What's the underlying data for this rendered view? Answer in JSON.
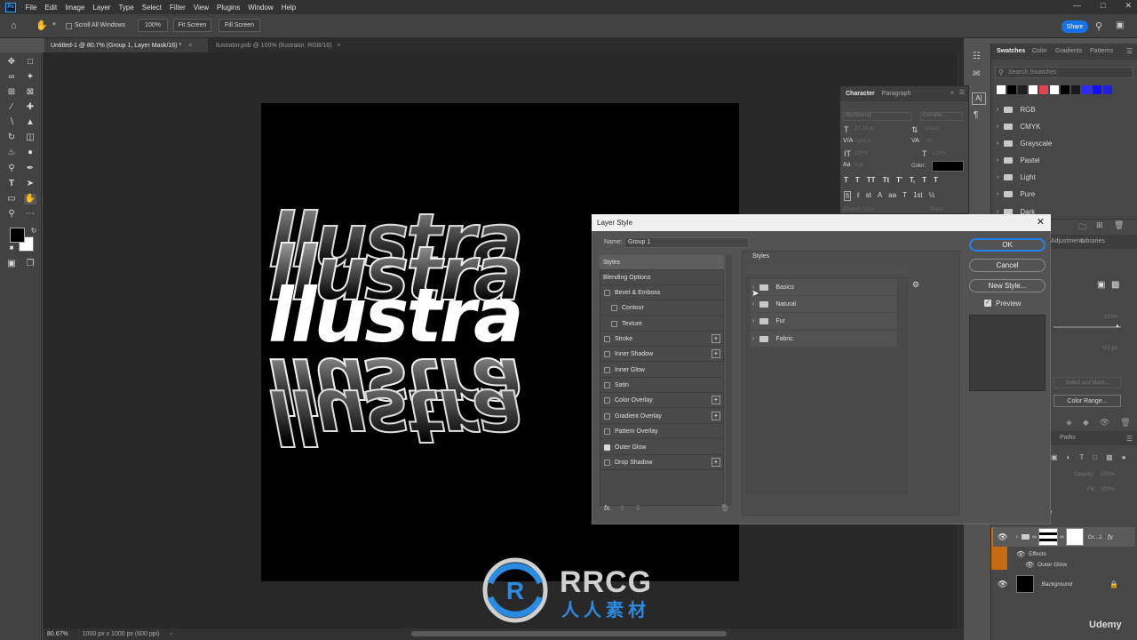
{
  "menu": [
    "File",
    "Edit",
    "Image",
    "Layer",
    "Type",
    "Select",
    "Filter",
    "View",
    "Plugins",
    "Window",
    "Help"
  ],
  "options": {
    "scroll_all": "Scroll All Windows",
    "zoom": "100%",
    "fit_screen": "Fit Screen",
    "fill_screen": "Fill Screen",
    "share": "Share"
  },
  "tabs": [
    {
      "label": "Untitled-1 @ 80.7% (Group 1, Layer Mask/16) *",
      "active": true
    },
    {
      "label": "llustrator.psb @ 100% (llustrator, RGB/16)",
      "active": false
    }
  ],
  "canvas": {
    "art_text": "llustra",
    "zoom_status": "80.67%",
    "doc_info": "1000 px x 1000 px (600 ppi)"
  },
  "character_panel": {
    "tabs": [
      "Character",
      "Paragraph"
    ],
    "font": "Montserrat",
    "style": "ExtraBo...",
    "size": "22.14 pt",
    "leading": "(Auto)",
    "kerning": "Optical",
    "tracking": "-40",
    "scale_v": "100%",
    "scale_h": "100%",
    "baseline": "0 pt",
    "color_label": "Color:",
    "lang": "English: USA",
    "aa": "Sharp"
  },
  "swatches_panel": {
    "tabs": [
      "Swatches",
      "Color",
      "Gradients",
      "Patterns"
    ],
    "search_placeholder": "Search Swatches",
    "colors": [
      "#ffffff",
      "#000000",
      "#1f1f1f",
      "#ffffff",
      "#e0474c",
      "#ffffff",
      "#000000",
      "#1a1a1a",
      "#2b2bff",
      "#1010ff",
      "#2020dd"
    ],
    "groups": [
      "RGB",
      "CMYK",
      "Grayscale",
      "Pastel",
      "Light",
      "Pure",
      "Dark"
    ]
  },
  "properties_panel": {
    "tabs": [
      "Adjustments",
      "Libraries"
    ],
    "density": "100%",
    "feather": "0.0 px",
    "select_mask": "Select and Mask...",
    "color_range": "Color Range..."
  },
  "layers_panel": {
    "tab": "Paths",
    "opacity_label": "Opacity:",
    "opacity": "100%",
    "fill_label": "Fill:",
    "fill": "100%",
    "layer_name_partial": "tor",
    "group_name": "Gr...1",
    "effects": "Effects",
    "effect_item": "Outer Glow",
    "background": "Background"
  },
  "dialog": {
    "title": "Layer Style",
    "name_label": "Name:",
    "name_value": "Group 1",
    "styles_items": [
      {
        "label": "Styles",
        "type": "header"
      },
      {
        "label": "Blending Options",
        "type": "header"
      },
      {
        "label": "Bevel & Emboss",
        "checked": false
      },
      {
        "label": "Contour",
        "checked": false,
        "indent": true
      },
      {
        "label": "Texture",
        "checked": false,
        "indent": true
      },
      {
        "label": "Stroke",
        "checked": false,
        "plus": true
      },
      {
        "label": "Inner Shadow",
        "checked": false,
        "plus": true
      },
      {
        "label": "Inner Glow",
        "checked": false
      },
      {
        "label": "Satin",
        "checked": false
      },
      {
        "label": "Color Overlay",
        "checked": false,
        "plus": true
      },
      {
        "label": "Gradient Overlay",
        "checked": false,
        "plus": true
      },
      {
        "label": "Pattern Overlay",
        "checked": false
      },
      {
        "label": "Outer Glow",
        "checked": true
      },
      {
        "label": "Drop Shadow",
        "checked": false,
        "plus": true
      }
    ],
    "styles_heading": "Styles",
    "style_groups": [
      "Basics",
      "Natural",
      "Fur",
      "Fabric"
    ],
    "ok": "OK",
    "cancel": "Cancel",
    "new_style": "New Style...",
    "preview": "Preview"
  },
  "watermark": {
    "brand": "RRCG",
    "sub": "人人素材"
  },
  "udemy": "Udemy"
}
